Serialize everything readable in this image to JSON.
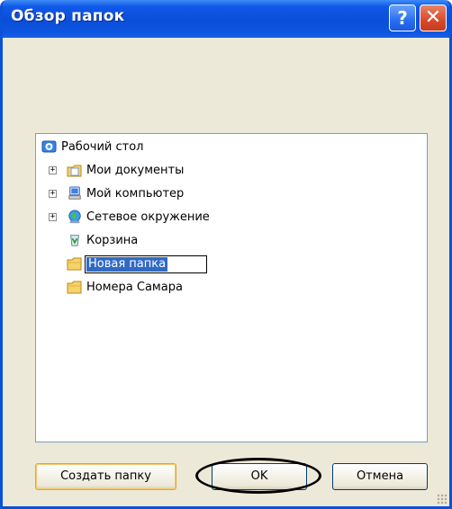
{
  "window": {
    "title": "Обзор папок",
    "help_glyph": "?",
    "close_glyph": "✕"
  },
  "tree": {
    "items": [
      {
        "label": "Рабочий стол",
        "icon": "desktop-icon"
      },
      {
        "label": "Мои документы",
        "icon": "my-documents-icon",
        "expander": "+"
      },
      {
        "label": "Мой компьютер",
        "icon": "my-computer-icon",
        "expander": "+"
      },
      {
        "label": "Сетевое окружение",
        "icon": "network-places-icon",
        "expander": "+"
      },
      {
        "label": "Корзина",
        "icon": "recycle-bin-icon"
      },
      {
        "label": "Новая папка",
        "icon": "folder-icon",
        "editing": true
      },
      {
        "label": "Номера Самара",
        "icon": "folder-icon"
      }
    ]
  },
  "buttons": {
    "create_folder": "Создать папку",
    "ok": "OK",
    "cancel": "Отмена"
  },
  "colors": {
    "titlebar": "#0a4ed8",
    "dialog_bg": "#ece9d8",
    "selection": "#316ac5"
  }
}
